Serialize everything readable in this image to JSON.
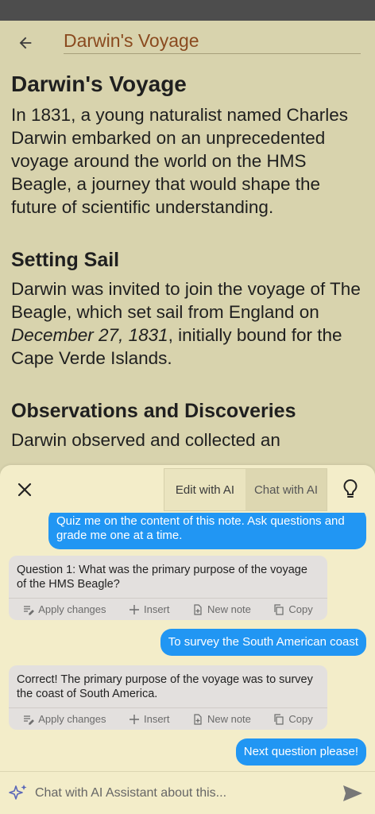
{
  "note": {
    "title_field": "Darwin's Voyage",
    "heading1": "Darwin's Voyage",
    "para1": "In 1831, a young naturalist named Charles Darwin embarked on an unprecedented voyage around the world on the HMS Beagle, a journey that would shape the future of scientific understanding.",
    "heading2": "Setting Sail",
    "para2_start": "Darwin was invited to join the voyage of The Beagle, which set sail from England on ",
    "para2_date": "December 27, 1831",
    "para2_end": ", initially bound for the Cape Verde Islands.",
    "heading3": "Observations and Discoveries",
    "para3_partial": "Darwin observed and collected an"
  },
  "panel": {
    "tabs": {
      "edit": "Edit with AI",
      "chat": "Chat with AI"
    },
    "icons": {
      "close": "close-icon",
      "bulb": "lightbulb-icon",
      "back": "arrow-left-icon",
      "sparkle": "sparkle-icon",
      "send": "send-icon"
    }
  },
  "chat": {
    "messages": [
      {
        "role": "user",
        "text": "Quiz me on the content of this note. Ask questions and grade me one at a time."
      },
      {
        "role": "ai",
        "text": "Question 1: What was the primary purpose of the voyage of the HMS Beagle?"
      },
      {
        "role": "user",
        "text": "To survey the South American coast"
      },
      {
        "role": "ai",
        "text": "Correct! The primary purpose of the voyage was to survey the coast of South America."
      },
      {
        "role": "user",
        "text": "Next question please!"
      }
    ],
    "actions": {
      "apply": "Apply changes",
      "insert": "Insert",
      "new_note": "New note",
      "copy": "Copy"
    }
  },
  "input": {
    "placeholder": "Chat with AI Assistant about this..."
  },
  "colors": {
    "accent": "#2196f3",
    "title": "#8a4a1f",
    "page_bg": "#d8d3ad",
    "panel_bg": "#f3edc9"
  }
}
